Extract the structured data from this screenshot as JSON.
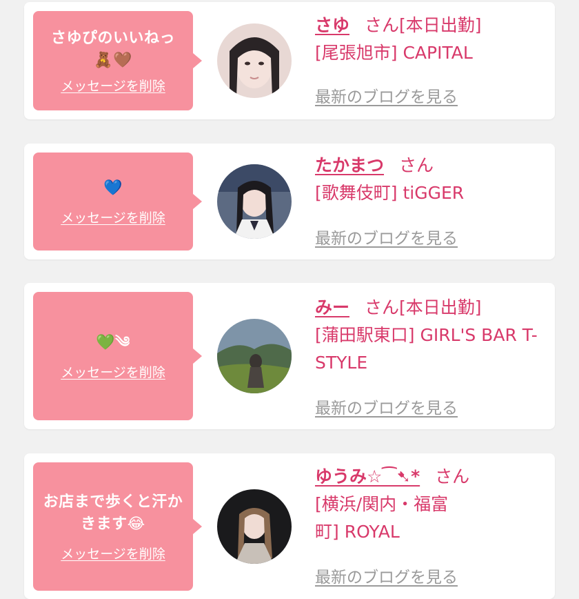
{
  "cards": [
    {
      "message": "さゆぴのいいねっ🧸🤎",
      "delete_label": "メッセージを削除",
      "name": "さゆ",
      "san": "さん",
      "tag": "[本日出勤]",
      "shop": "[尾張旭市] CAPITAL",
      "blog_label": "最新のブログを見る"
    },
    {
      "message": "💙",
      "delete_label": "メッセージを削除",
      "name": "たかまつ",
      "san": "さん",
      "tag": "",
      "shop": "[歌舞伎町] tiGGER",
      "blog_label": "最新のブログを見る"
    },
    {
      "message": "💚༄",
      "delete_label": "メッセージを削除",
      "name": "みー",
      "san": "さん",
      "tag": "[本日出勤]",
      "shop": "[蒲田駅東口] GIRL'S BAR T-STYLE",
      "blog_label": "最新のブログを見る"
    },
    {
      "message": "お店まで歩くと汗かきます😂",
      "delete_label": "メッセージを削除",
      "name": "ゆうみ☆⁀➷*",
      "san": "さん",
      "tag": "",
      "shop": "[横浜/関内・福富町] ROYAL",
      "blog_label": "最新のブログを見る"
    }
  ],
  "colors": {
    "accent": "#d8396a",
    "bubble": "#f7919e",
    "muted": "#9a9a9a"
  }
}
